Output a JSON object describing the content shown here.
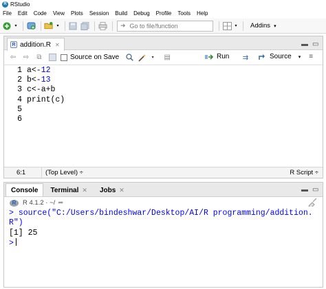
{
  "window": {
    "title": "RStudio"
  },
  "menu": [
    "File",
    "Edit",
    "Code",
    "View",
    "Plots",
    "Session",
    "Build",
    "Debug",
    "Profile",
    "Tools",
    "Help"
  ],
  "toolbar": {
    "goto_placeholder": "Go to file/function",
    "addins_label": "Addins"
  },
  "editor": {
    "tab_label": "addition.R",
    "source_on_save_label": "Source on Save",
    "run_label": "Run",
    "source_label": "Source",
    "lines": [
      {
        "n": "1",
        "pre": "a<-",
        "num": "12",
        "post": ""
      },
      {
        "n": "2",
        "pre": "b<-",
        "num": "13",
        "post": ""
      },
      {
        "n": "3",
        "pre": "c<-a+b",
        "num": "",
        "post": ""
      },
      {
        "n": "4",
        "pre": "print(c)",
        "num": "",
        "post": ""
      },
      {
        "n": "5",
        "pre": "",
        "num": "",
        "post": ""
      },
      {
        "n": "6",
        "pre": "",
        "num": "",
        "post": ""
      }
    ],
    "cursor_position": "6:1",
    "scope": "(Top Level) ÷",
    "file_type": "R Script ÷"
  },
  "console": {
    "tabs": [
      {
        "label": "Console",
        "closable": false
      },
      {
        "label": "Terminal",
        "closable": true
      },
      {
        "label": "Jobs",
        "closable": true
      }
    ],
    "r_version": "R 4.1.2 · ~/",
    "lines": [
      {
        "kind": "cmd",
        "prompt": ">",
        "text": "source(\"C:/Users/bindeshwar/Desktop/AI/R programming/addition."
      },
      {
        "kind": "cmd",
        "prompt": "",
        "text": "R\")"
      },
      {
        "kind": "out",
        "prompt": "",
        "text": "[1] 25"
      }
    ],
    "final_prompt": ">"
  }
}
